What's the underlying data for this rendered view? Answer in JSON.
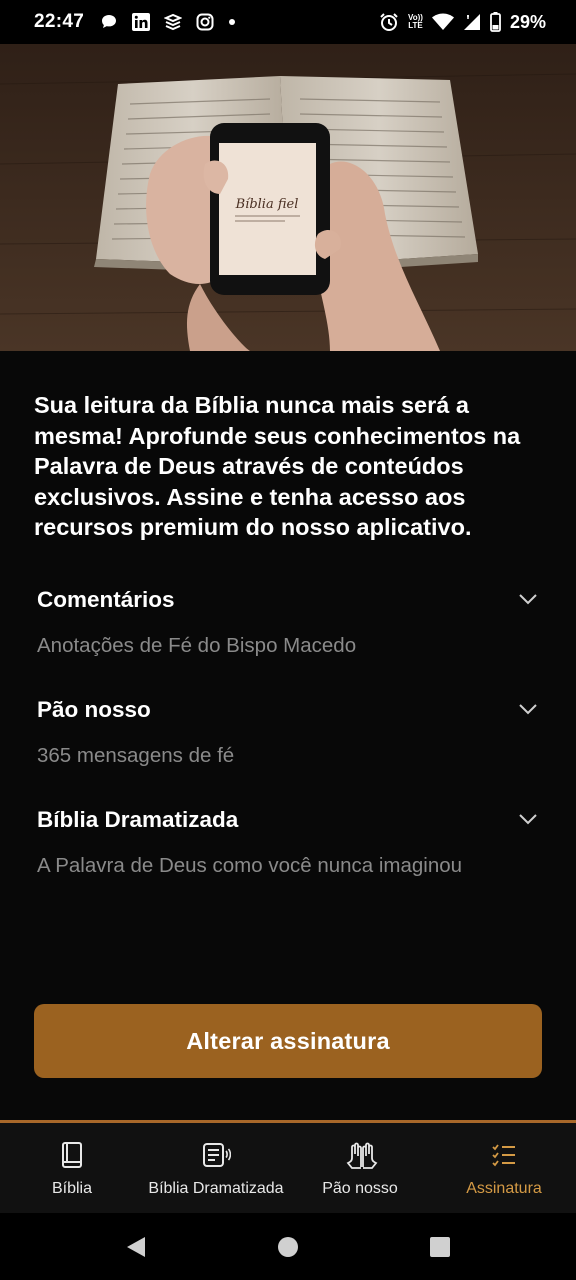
{
  "status_bar": {
    "time": "22:47",
    "battery_percent": "29%",
    "network_label_top": "Vo))",
    "network_label_bottom": "LTE",
    "left_icons": [
      "chat-bubble-icon",
      "linkedin-icon",
      "stack-icon",
      "instagram-icon",
      "dot-icon"
    ],
    "right_icons": [
      "alarm-icon",
      "volte-icon",
      "wifi-icon",
      "signal-icon",
      "battery-icon"
    ]
  },
  "hero": {
    "phone_screen_title": "Bíblia fiel"
  },
  "intro_text": "Sua leitura da Bíblia nunca mais será a mesma! Aprofunde seus conhecimentos na Palavra de Deus através de conteúdos exclusivos. Assine e tenha acesso aos recursos premium do nosso aplicativo.",
  "features": [
    {
      "title": "Comentários",
      "subtitle": "Anotações de Fé do Bispo Macedo"
    },
    {
      "title": "Pão nosso",
      "subtitle": "365 mensagens de fé"
    },
    {
      "title": "Bíblia Dramatizada",
      "subtitle": "A Palavra de Deus como você nunca imaginou"
    }
  ],
  "cta_label": "Alterar assinatura",
  "tabs": [
    {
      "label": "Bíblia",
      "icon": "book-icon",
      "active": false
    },
    {
      "label": "Bíblia Dramatizada",
      "icon": "audio-book-icon",
      "active": false
    },
    {
      "label": "Pão nosso",
      "icon": "praying-hands-icon",
      "active": false
    },
    {
      "label": "Assinatura",
      "icon": "checklist-icon",
      "active": true
    }
  ],
  "colors": {
    "background": "#080808",
    "accent_button": "#9b6220",
    "active_tab": "#d49a45",
    "subtitle_gray": "#8a8a8a"
  }
}
